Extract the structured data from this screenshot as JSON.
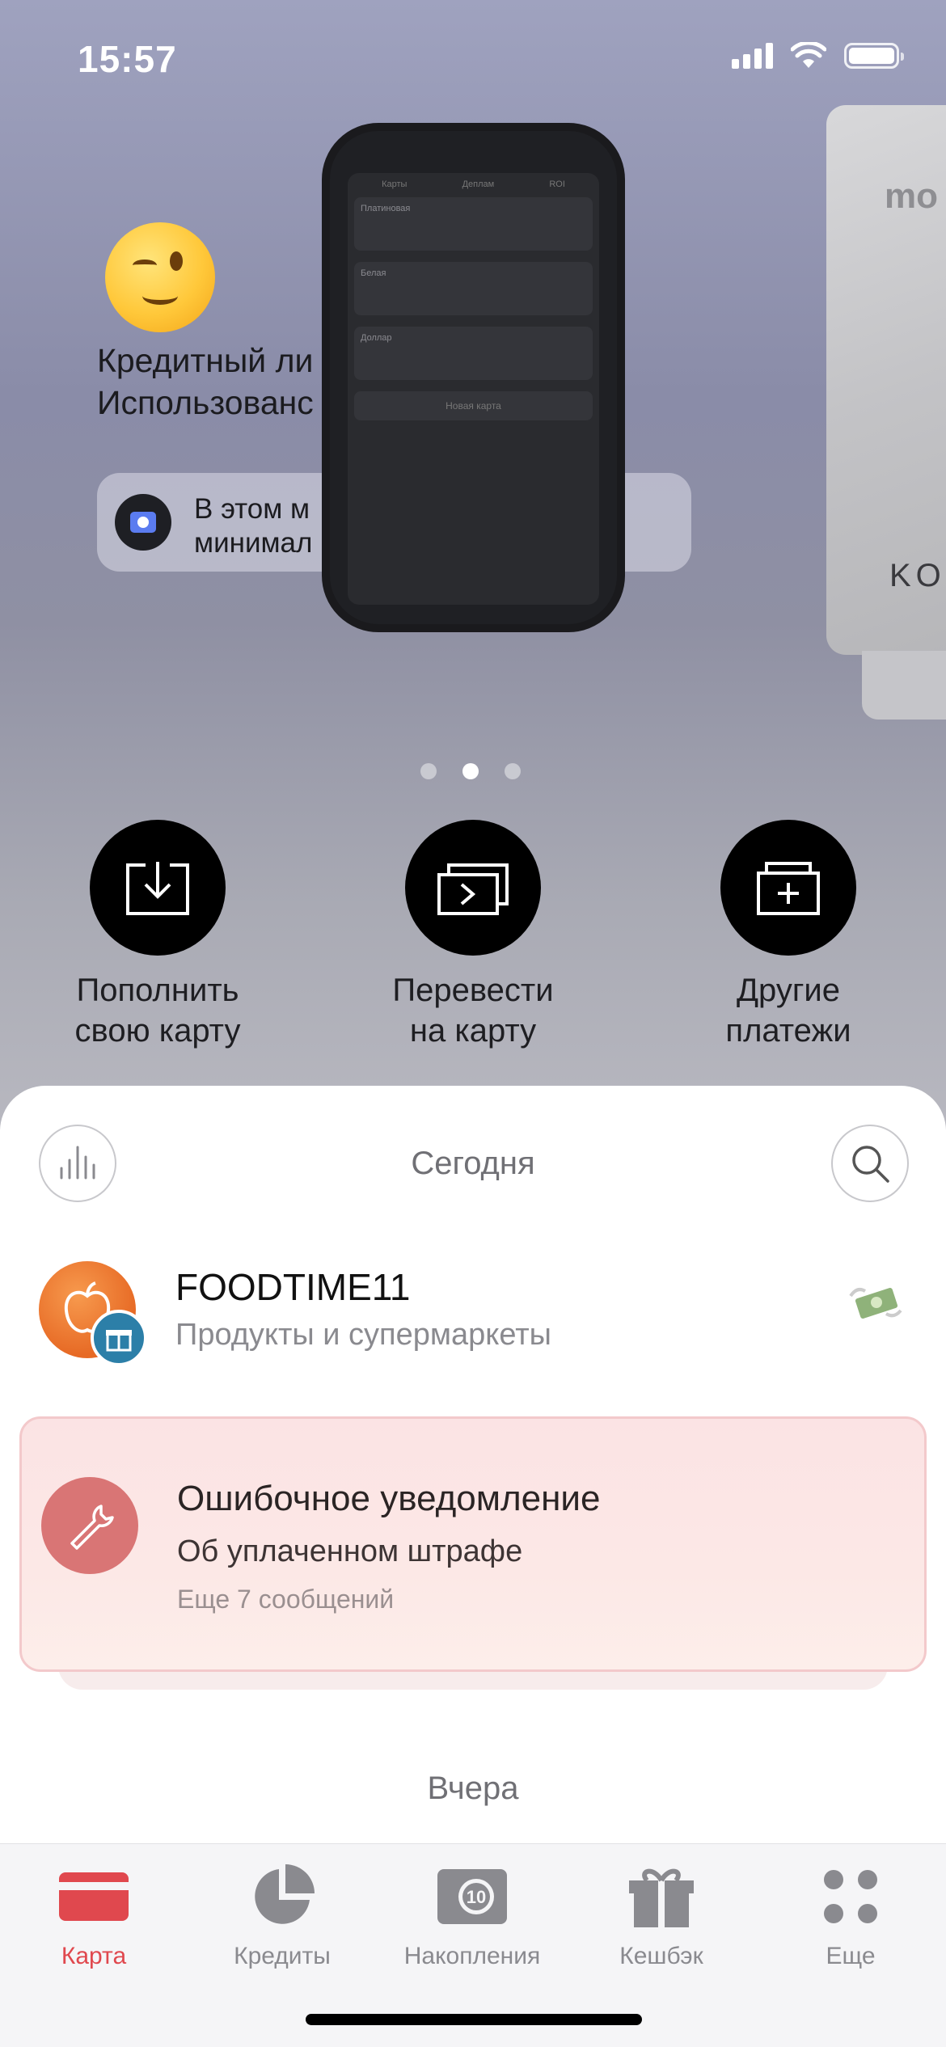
{
  "status_bar": {
    "time": "15:57"
  },
  "promo": {
    "credit_line1": "Кредитный ли",
    "credit_line2": "Использованс",
    "info_line1": "В этом м",
    "info_line2": "минимал",
    "card_brand": "mo",
    "card_name": "KOS",
    "phone_tabs": [
      "Карты",
      "Деплам",
      "ROI"
    ],
    "phone_rows": [
      "Платиновая",
      "Белая",
      "Доллар"
    ],
    "phone_new_card": "Новая карта"
  },
  "carousel": {
    "pages": 3,
    "active_index": 1
  },
  "actions": [
    {
      "line1": "Пополнить",
      "line2": "свою карту",
      "icon": "download-tray-icon"
    },
    {
      "line1": "Перевести",
      "line2": "на карту",
      "icon": "transfer-cards-icon"
    },
    {
      "line1": "Другие",
      "line2": "платежи",
      "icon": "add-folder-icon"
    }
  ],
  "feed": {
    "today_label": "Сегодня",
    "yesterday_label": "Вчера",
    "transaction": {
      "merchant": "FOODTIME11",
      "category": "Продукты и супермаркеты",
      "icon": "apple-icon",
      "badge_icon": "gift-icon"
    },
    "notification": {
      "title": "Ошибочное уведомление",
      "subtitle": "Об уплаченном штрафе",
      "more": "Еще 7 сообщений",
      "icon": "wrench-icon"
    }
  },
  "tabbar": {
    "items": [
      {
        "label": "Карта",
        "icon": "card-icon",
        "active": true
      },
      {
        "label": "Кредиты",
        "icon": "pie-chart-icon",
        "active": false
      },
      {
        "label": "Накопления",
        "icon": "savings-10-icon",
        "active": false
      },
      {
        "label": "Кешбэк",
        "icon": "gift-icon",
        "active": false
      },
      {
        "label": "Еще",
        "icon": "grid-dots-icon",
        "active": false
      }
    ]
  },
  "colors": {
    "accent": "#e0484e",
    "notification_bg": "#fbe3e4",
    "wrench_bg": "#d97575"
  }
}
